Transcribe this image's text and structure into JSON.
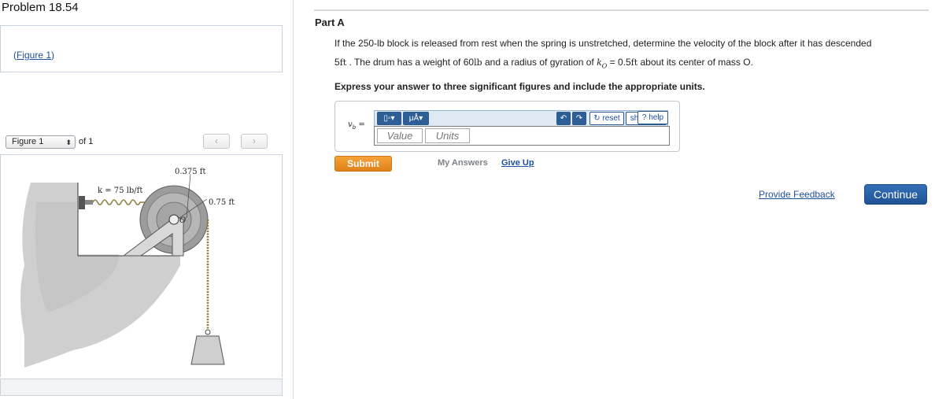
{
  "problem": {
    "title": "Problem 18.54"
  },
  "figure_link": {
    "open": "(",
    "label": "Figure 1",
    "close": ")"
  },
  "figure_nav": {
    "selected": "Figure 1",
    "of_text": "of 1",
    "prev_icon": "‹",
    "next_icon": "›"
  },
  "figure": {
    "label_top": "0.375 ft",
    "label_spring": "k = 75 lb/ft",
    "label_radius": "0.75 ft",
    "label_center": "O"
  },
  "part": {
    "title": "Part A"
  },
  "question": {
    "line1": "If the 250-lb block is released from rest when the spring is unstretched, determine the velocity of the block after it has descended",
    "line2_a": "5",
    "line2_b": "ft",
    "line2_c": " . The drum has a weight of ",
    "line2_d": "60",
    "line2_e": "lb",
    "line2_f": " and a radius of gyration of ",
    "line2_g": "k",
    "line2_h": "O",
    "line2_i": " = 0.5",
    "line2_j": "ft",
    "line2_k": " about its center of mass O."
  },
  "instructions": "Express your answer to three significant figures and include the appropriate units.",
  "answer": {
    "variable": "v",
    "variable_sub": "b",
    "equals": "=",
    "value_placeholder": "Value",
    "units_placeholder": "Units"
  },
  "toolbar": {
    "templates_label": "▯▫▾",
    "symbols_label": "μÅ▾",
    "undo_icon": "↶",
    "redo_icon": "↷",
    "reset_label": "↻ reset",
    "shortcuts_label": "shortcuts",
    "help_label": "? help"
  },
  "actions": {
    "submit_label": "Submit",
    "my_answers_label": "My Answers",
    "give_up_label": "Give Up",
    "feedback_label": "Provide Feedback",
    "continue_label": "Continue"
  },
  "colors": {
    "link": "#1d4f9a",
    "submit": "#e98a24",
    "continue": "#2a62a6",
    "toolbar_blue": "#2d5f96"
  }
}
